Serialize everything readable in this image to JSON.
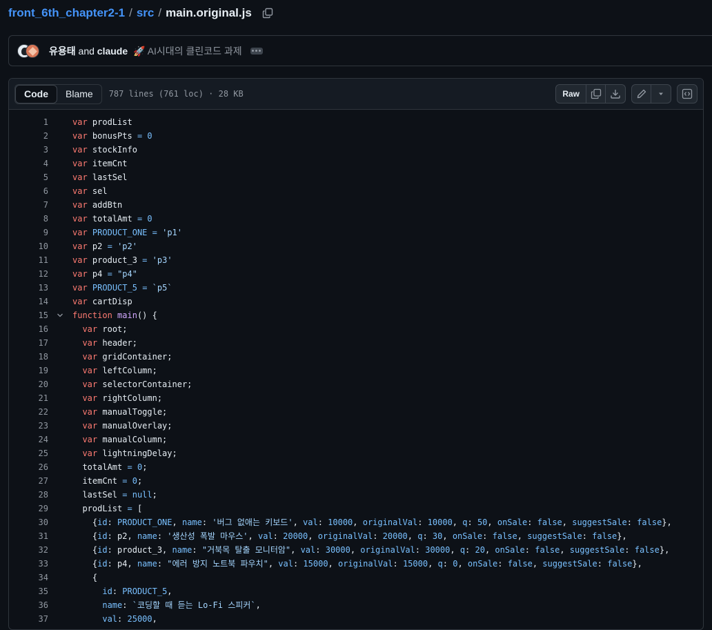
{
  "breadcrumb": {
    "repo": "front_6th_chapter2-1",
    "sep1": "/",
    "dir": "src",
    "sep2": "/",
    "file": "main.original.js"
  },
  "commit": {
    "author1": "유용태",
    "and": "and",
    "author2": "claude",
    "message": "🚀 AI시대의 클린코드 과제"
  },
  "file_header": {
    "tab_code": "Code",
    "tab_blame": "Blame",
    "meta": "787 lines (761 loc) · 28 KB",
    "raw_label": "Raw"
  },
  "icons": [
    "copy-icon",
    "download-icon",
    "pencil-icon",
    "triangle-down-icon",
    "code-square-icon",
    "chevron-down-icon",
    "kebab-icon"
  ],
  "colors": {
    "keyword": "#ff7b72",
    "constant": "#79c0ff",
    "string": "#a5d6ff",
    "function": "#d2a8ff",
    "link": "#4493f8"
  },
  "code_lines": [
    {
      "n": "1",
      "t": [
        [
          "k",
          "var"
        ],
        [
          "p",
          " prodList"
        ]
      ]
    },
    {
      "n": "2",
      "t": [
        [
          "k",
          "var"
        ],
        [
          "p",
          " bonusPts "
        ],
        [
          "c",
          "="
        ],
        [
          "p",
          " "
        ],
        [
          "c",
          "0"
        ]
      ]
    },
    {
      "n": "3",
      "t": [
        [
          "k",
          "var"
        ],
        [
          "p",
          " stockInfo"
        ]
      ]
    },
    {
      "n": "4",
      "t": [
        [
          "k",
          "var"
        ],
        [
          "p",
          " itemCnt"
        ]
      ]
    },
    {
      "n": "5",
      "t": [
        [
          "k",
          "var"
        ],
        [
          "p",
          " lastSel"
        ]
      ]
    },
    {
      "n": "6",
      "t": [
        [
          "k",
          "var"
        ],
        [
          "p",
          " sel"
        ]
      ]
    },
    {
      "n": "7",
      "t": [
        [
          "k",
          "var"
        ],
        [
          "p",
          " addBtn"
        ]
      ]
    },
    {
      "n": "8",
      "t": [
        [
          "k",
          "var"
        ],
        [
          "p",
          " totalAmt "
        ],
        [
          "c",
          "="
        ],
        [
          "p",
          " "
        ],
        [
          "c",
          "0"
        ]
      ]
    },
    {
      "n": "9",
      "t": [
        [
          "k",
          "var"
        ],
        [
          "p",
          " "
        ],
        [
          "c",
          "PRODUCT_ONE"
        ],
        [
          "p",
          " "
        ],
        [
          "c",
          "="
        ],
        [
          "p",
          " "
        ],
        [
          "s",
          "'p1'"
        ]
      ]
    },
    {
      "n": "10",
      "t": [
        [
          "k",
          "var"
        ],
        [
          "p",
          " p2 "
        ],
        [
          "c",
          "="
        ],
        [
          "p",
          " "
        ],
        [
          "s",
          "'p2'"
        ]
      ]
    },
    {
      "n": "11",
      "t": [
        [
          "k",
          "var"
        ],
        [
          "p",
          " product_3 "
        ],
        [
          "c",
          "="
        ],
        [
          "p",
          " "
        ],
        [
          "s",
          "'p3'"
        ]
      ]
    },
    {
      "n": "12",
      "t": [
        [
          "k",
          "var"
        ],
        [
          "p",
          " p4 "
        ],
        [
          "c",
          "="
        ],
        [
          "p",
          " "
        ],
        [
          "s",
          "\"p4\""
        ]
      ]
    },
    {
      "n": "13",
      "t": [
        [
          "k",
          "var"
        ],
        [
          "p",
          " "
        ],
        [
          "c",
          "PRODUCT_5"
        ],
        [
          "p",
          " "
        ],
        [
          "c",
          "="
        ],
        [
          "p",
          " "
        ],
        [
          "s",
          "`p5`"
        ]
      ]
    },
    {
      "n": "14",
      "t": [
        [
          "k",
          "var"
        ],
        [
          "p",
          " cartDisp"
        ]
      ]
    },
    {
      "n": "15",
      "fold": true,
      "t": [
        [
          "k",
          "function"
        ],
        [
          "p",
          " "
        ],
        [
          "f",
          "main"
        ],
        [
          "p",
          "() {"
        ]
      ]
    },
    {
      "n": "16",
      "t": [
        [
          "p",
          "  "
        ],
        [
          "k",
          "var"
        ],
        [
          "p",
          " root;"
        ]
      ]
    },
    {
      "n": "17",
      "t": [
        [
          "p",
          "  "
        ],
        [
          "k",
          "var"
        ],
        [
          "p",
          " header;"
        ]
      ]
    },
    {
      "n": "18",
      "t": [
        [
          "p",
          "  "
        ],
        [
          "k",
          "var"
        ],
        [
          "p",
          " gridContainer;"
        ]
      ]
    },
    {
      "n": "19",
      "t": [
        [
          "p",
          "  "
        ],
        [
          "k",
          "var"
        ],
        [
          "p",
          " leftColumn;"
        ]
      ]
    },
    {
      "n": "20",
      "t": [
        [
          "p",
          "  "
        ],
        [
          "k",
          "var"
        ],
        [
          "p",
          " selectorContainer;"
        ]
      ]
    },
    {
      "n": "21",
      "t": [
        [
          "p",
          "  "
        ],
        [
          "k",
          "var"
        ],
        [
          "p",
          " rightColumn;"
        ]
      ]
    },
    {
      "n": "22",
      "t": [
        [
          "p",
          "  "
        ],
        [
          "k",
          "var"
        ],
        [
          "p",
          " manualToggle;"
        ]
      ]
    },
    {
      "n": "23",
      "t": [
        [
          "p",
          "  "
        ],
        [
          "k",
          "var"
        ],
        [
          "p",
          " manualOverlay;"
        ]
      ]
    },
    {
      "n": "24",
      "t": [
        [
          "p",
          "  "
        ],
        [
          "k",
          "var"
        ],
        [
          "p",
          " manualColumn;"
        ]
      ]
    },
    {
      "n": "25",
      "t": [
        [
          "p",
          "  "
        ],
        [
          "k",
          "var"
        ],
        [
          "p",
          " lightningDelay;"
        ]
      ]
    },
    {
      "n": "26",
      "t": [
        [
          "p",
          "  totalAmt "
        ],
        [
          "c",
          "="
        ],
        [
          "p",
          " "
        ],
        [
          "c",
          "0"
        ],
        [
          "p",
          ";"
        ]
      ]
    },
    {
      "n": "27",
      "t": [
        [
          "p",
          "  itemCnt "
        ],
        [
          "c",
          "="
        ],
        [
          "p",
          " "
        ],
        [
          "c",
          "0"
        ],
        [
          "p",
          ";"
        ]
      ]
    },
    {
      "n": "28",
      "t": [
        [
          "p",
          "  lastSel "
        ],
        [
          "c",
          "="
        ],
        [
          "p",
          " "
        ],
        [
          "c",
          "null"
        ],
        [
          "p",
          ";"
        ]
      ]
    },
    {
      "n": "29",
      "t": [
        [
          "p",
          "  prodList "
        ],
        [
          "c",
          "="
        ],
        [
          "p",
          " ["
        ]
      ]
    },
    {
      "n": "30",
      "t": [
        [
          "p",
          "    {"
        ],
        [
          "c",
          "id"
        ],
        [
          "p",
          ": "
        ],
        [
          "c",
          "PRODUCT_ONE"
        ],
        [
          "p",
          ", "
        ],
        [
          "c",
          "name"
        ],
        [
          "p",
          ": "
        ],
        [
          "s",
          "'버그 없애는 키보드'"
        ],
        [
          "p",
          ", "
        ],
        [
          "c",
          "val"
        ],
        [
          "p",
          ": "
        ],
        [
          "c",
          "10000"
        ],
        [
          "p",
          ", "
        ],
        [
          "c",
          "originalVal"
        ],
        [
          "p",
          ": "
        ],
        [
          "c",
          "10000"
        ],
        [
          "p",
          ", "
        ],
        [
          "c",
          "q"
        ],
        [
          "p",
          ": "
        ],
        [
          "c",
          "50"
        ],
        [
          "p",
          ", "
        ],
        [
          "c",
          "onSale"
        ],
        [
          "p",
          ": "
        ],
        [
          "c",
          "false"
        ],
        [
          "p",
          ", "
        ],
        [
          "c",
          "suggestSale"
        ],
        [
          "p",
          ": "
        ],
        [
          "c",
          "false"
        ],
        [
          "p",
          "},"
        ]
      ]
    },
    {
      "n": "31",
      "t": [
        [
          "p",
          "    {"
        ],
        [
          "c",
          "id"
        ],
        [
          "p",
          ": p2, "
        ],
        [
          "c",
          "name"
        ],
        [
          "p",
          ": "
        ],
        [
          "s",
          "'생산성 폭발 마우스'"
        ],
        [
          "p",
          ", "
        ],
        [
          "c",
          "val"
        ],
        [
          "p",
          ": "
        ],
        [
          "c",
          "20000"
        ],
        [
          "p",
          ", "
        ],
        [
          "c",
          "originalVal"
        ],
        [
          "p",
          ": "
        ],
        [
          "c",
          "20000"
        ],
        [
          "p",
          ", "
        ],
        [
          "c",
          "q"
        ],
        [
          "p",
          ": "
        ],
        [
          "c",
          "30"
        ],
        [
          "p",
          ", "
        ],
        [
          "c",
          "onSale"
        ],
        [
          "p",
          ": "
        ],
        [
          "c",
          "false"
        ],
        [
          "p",
          ", "
        ],
        [
          "c",
          "suggestSale"
        ],
        [
          "p",
          ": "
        ],
        [
          "c",
          "false"
        ],
        [
          "p",
          "},"
        ]
      ]
    },
    {
      "n": "32",
      "t": [
        [
          "p",
          "    {"
        ],
        [
          "c",
          "id"
        ],
        [
          "p",
          ": product_3, "
        ],
        [
          "c",
          "name"
        ],
        [
          "p",
          ": "
        ],
        [
          "s",
          "\"거북목 탈출 모니터암\""
        ],
        [
          "p",
          ", "
        ],
        [
          "c",
          "val"
        ],
        [
          "p",
          ": "
        ],
        [
          "c",
          "30000"
        ],
        [
          "p",
          ", "
        ],
        [
          "c",
          "originalVal"
        ],
        [
          "p",
          ": "
        ],
        [
          "c",
          "30000"
        ],
        [
          "p",
          ", "
        ],
        [
          "c",
          "q"
        ],
        [
          "p",
          ": "
        ],
        [
          "c",
          "20"
        ],
        [
          "p",
          ", "
        ],
        [
          "c",
          "onSale"
        ],
        [
          "p",
          ": "
        ],
        [
          "c",
          "false"
        ],
        [
          "p",
          ", "
        ],
        [
          "c",
          "suggestSale"
        ],
        [
          "p",
          ": "
        ],
        [
          "c",
          "false"
        ],
        [
          "p",
          "},"
        ]
      ]
    },
    {
      "n": "33",
      "t": [
        [
          "p",
          "    {"
        ],
        [
          "c",
          "id"
        ],
        [
          "p",
          ": p4, "
        ],
        [
          "c",
          "name"
        ],
        [
          "p",
          ": "
        ],
        [
          "s",
          "\"에러 방지 노트북 파우치\""
        ],
        [
          "p",
          ", "
        ],
        [
          "c",
          "val"
        ],
        [
          "p",
          ": "
        ],
        [
          "c",
          "15000"
        ],
        [
          "p",
          ", "
        ],
        [
          "c",
          "originalVal"
        ],
        [
          "p",
          ": "
        ],
        [
          "c",
          "15000"
        ],
        [
          "p",
          ", "
        ],
        [
          "c",
          "q"
        ],
        [
          "p",
          ": "
        ],
        [
          "c",
          "0"
        ],
        [
          "p",
          ", "
        ],
        [
          "c",
          "onSale"
        ],
        [
          "p",
          ": "
        ],
        [
          "c",
          "false"
        ],
        [
          "p",
          ", "
        ],
        [
          "c",
          "suggestSale"
        ],
        [
          "p",
          ": "
        ],
        [
          "c",
          "false"
        ],
        [
          "p",
          "},"
        ]
      ]
    },
    {
      "n": "34",
      "t": [
        [
          "p",
          "    {"
        ]
      ]
    },
    {
      "n": "35",
      "t": [
        [
          "p",
          "      "
        ],
        [
          "c",
          "id"
        ],
        [
          "p",
          ": "
        ],
        [
          "c",
          "PRODUCT_5"
        ],
        [
          "p",
          ","
        ]
      ]
    },
    {
      "n": "36",
      "t": [
        [
          "p",
          "      "
        ],
        [
          "c",
          "name"
        ],
        [
          "p",
          ": "
        ],
        [
          "s",
          "`코딩할 때 듣는 Lo-Fi 스피커`"
        ],
        [
          "p",
          ","
        ]
      ]
    },
    {
      "n": "37",
      "t": [
        [
          "p",
          "      "
        ],
        [
          "c",
          "val"
        ],
        [
          "p",
          ": "
        ],
        [
          "c",
          "25000"
        ],
        [
          "p",
          ","
        ]
      ]
    }
  ]
}
